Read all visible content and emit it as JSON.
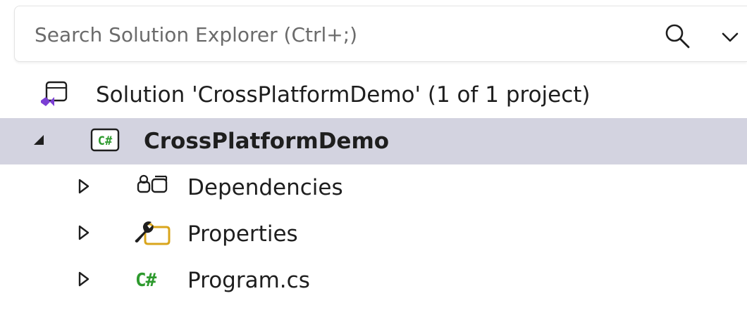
{
  "search": {
    "placeholder": "Search Solution Explorer (Ctrl+;)",
    "value": "",
    "search_icon": "search-icon",
    "options_icon": "chevron-down-icon"
  },
  "tree": {
    "solution": {
      "label": "Solution 'CrossPlatformDemo' (1 of 1 project)",
      "icon": "visual-studio-solution-icon"
    },
    "project": {
      "label": "CrossPlatformDemo",
      "icon": "csharp-project-icon",
      "expanded": true,
      "selected": true
    },
    "children": [
      {
        "label": "Dependencies",
        "icon": "dependencies-icon",
        "expanded": false
      },
      {
        "label": "Properties",
        "icon": "properties-folder-icon",
        "expanded": false
      },
      {
        "label": "Program.cs",
        "icon": "csharp-file-icon",
        "icon_text": "C#",
        "expanded": false
      }
    ]
  },
  "colors": {
    "selection_background": "#d3d3e0",
    "csharp_green": "#2e9a2e",
    "solution_purple": "#7b3fd4",
    "properties_yellow": "#d9a51c"
  }
}
